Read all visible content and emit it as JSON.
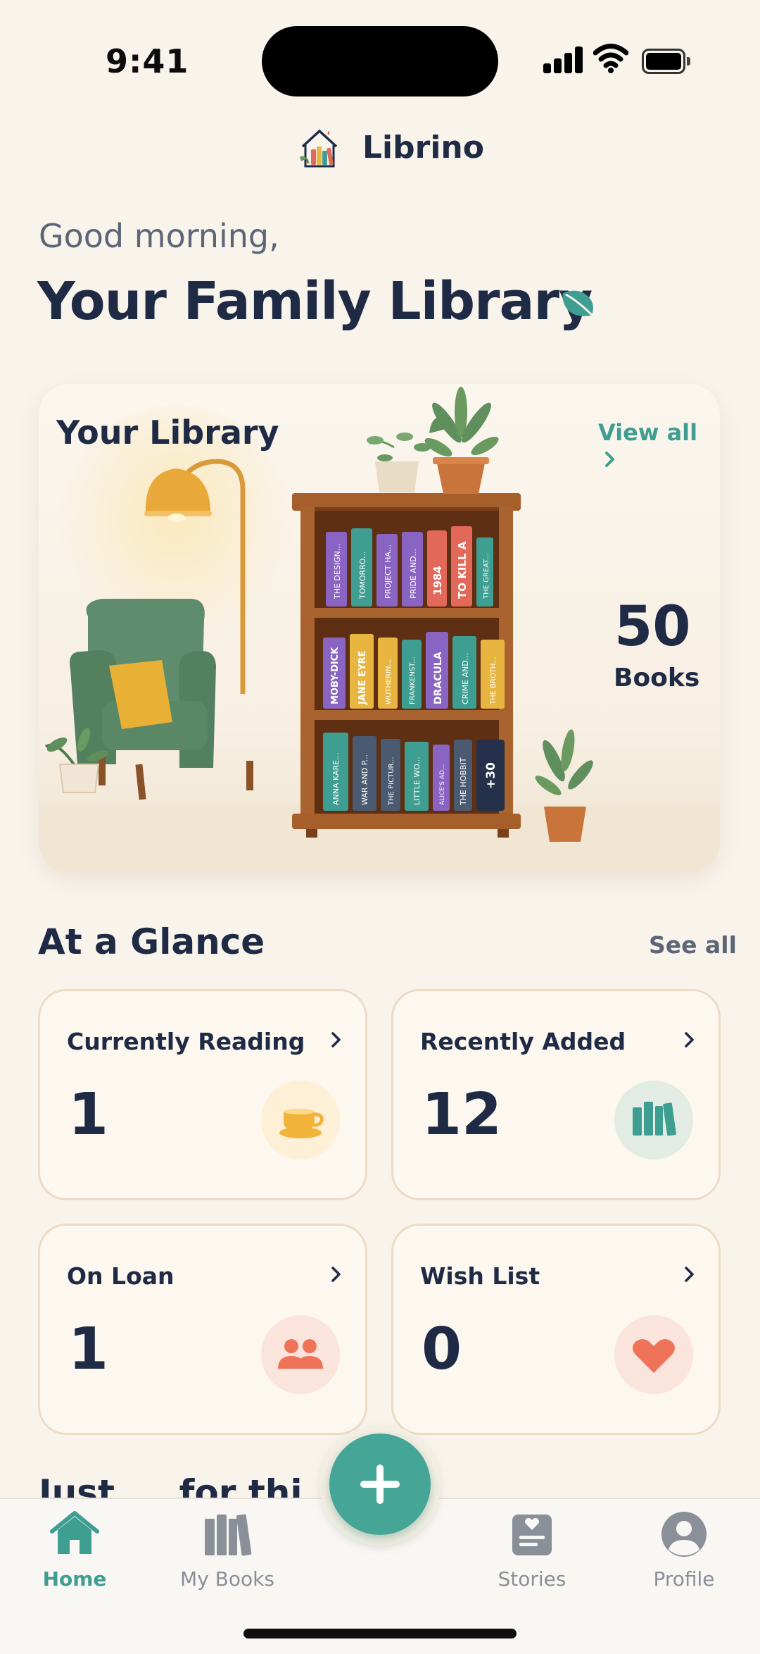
{
  "status": {
    "time": "9:41"
  },
  "header": {
    "app_name": "Librino"
  },
  "greeting": "Good morning,",
  "title": "Your Family Library",
  "library": {
    "title": "Your Library",
    "view_all": "View all",
    "count": "50",
    "count_label": "Books",
    "shelves": [
      [
        "THE DESIGN...",
        "TOMORRO...",
        "PROJECT HA...",
        "PRIDE AND...",
        "1984",
        "TO KILL A",
        "THE GREAT..."
      ],
      [
        "MOBY-DICK",
        "JANE EYRE",
        "WUTHERIN...",
        "FRANKENST...",
        "DRACULA",
        "CRIME AND...",
        "THE BROTH..."
      ],
      [
        "ANNA KARE...",
        "WAR AND P...",
        "THE PICTUR...",
        "LITTLE WO...",
        "ALICE'S AD...",
        "THE HOBBIT",
        "+30"
      ]
    ]
  },
  "glance": {
    "title": "At a Glance",
    "see_all": "See all",
    "cards": [
      {
        "label": "Currently Reading",
        "value": "1",
        "icon": "coffee-cup-icon"
      },
      {
        "label": "Recently Added",
        "value": "12",
        "icon": "books-icon"
      },
      {
        "label": "On Loan",
        "value": "1",
        "icon": "people-icon"
      },
      {
        "label": "Wish List",
        "value": "0",
        "icon": "heart-icon"
      }
    ]
  },
  "peek_section_title": "Just ... for thi",
  "tabs": [
    {
      "label": "Home",
      "icon": "home-icon",
      "active": true
    },
    {
      "label": "My Books",
      "icon": "books-icon"
    },
    {
      "label": "Stories",
      "icon": "stories-icon"
    },
    {
      "label": "Profile",
      "icon": "profile-icon"
    }
  ],
  "colors": {
    "background": "#f8f4ec",
    "accent": "#45a597",
    "text": "#1f2a44",
    "muted": "#5c6676"
  }
}
